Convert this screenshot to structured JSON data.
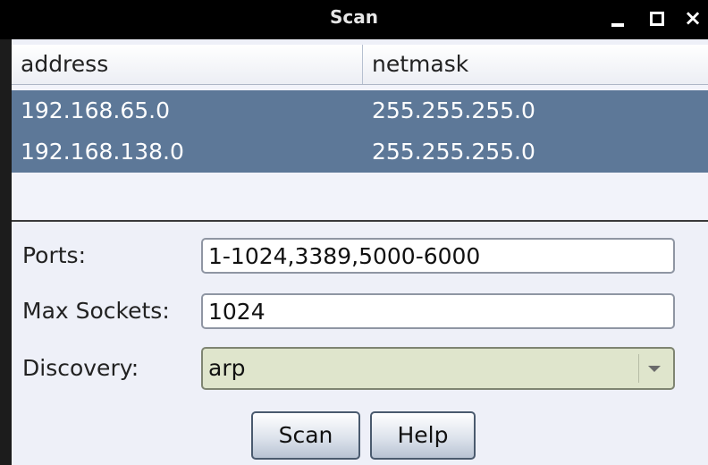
{
  "window": {
    "title": "Scan",
    "controls": {
      "minimize": "minimize",
      "maximize": "maximize",
      "close": "×"
    }
  },
  "table": {
    "columns": [
      "address",
      "netmask"
    ],
    "rows": [
      [
        "192.168.65.0",
        "255.255.255.0"
      ],
      [
        "192.168.138.0",
        "255.255.255.0"
      ]
    ]
  },
  "form": {
    "ports_label": "Ports:",
    "ports_value": "1-1024,3389,5000-6000",
    "max_sockets_label": "Max Sockets:",
    "max_sockets_value": "1024",
    "discovery_label": "Discovery:",
    "discovery_value": "arp"
  },
  "buttons": {
    "scan_label": "Scan",
    "help_label": "Help"
  },
  "colors": {
    "selected_row": "#5d7898",
    "window_bg": "#eef0f8",
    "select_bg": "#dfe5cc"
  }
}
